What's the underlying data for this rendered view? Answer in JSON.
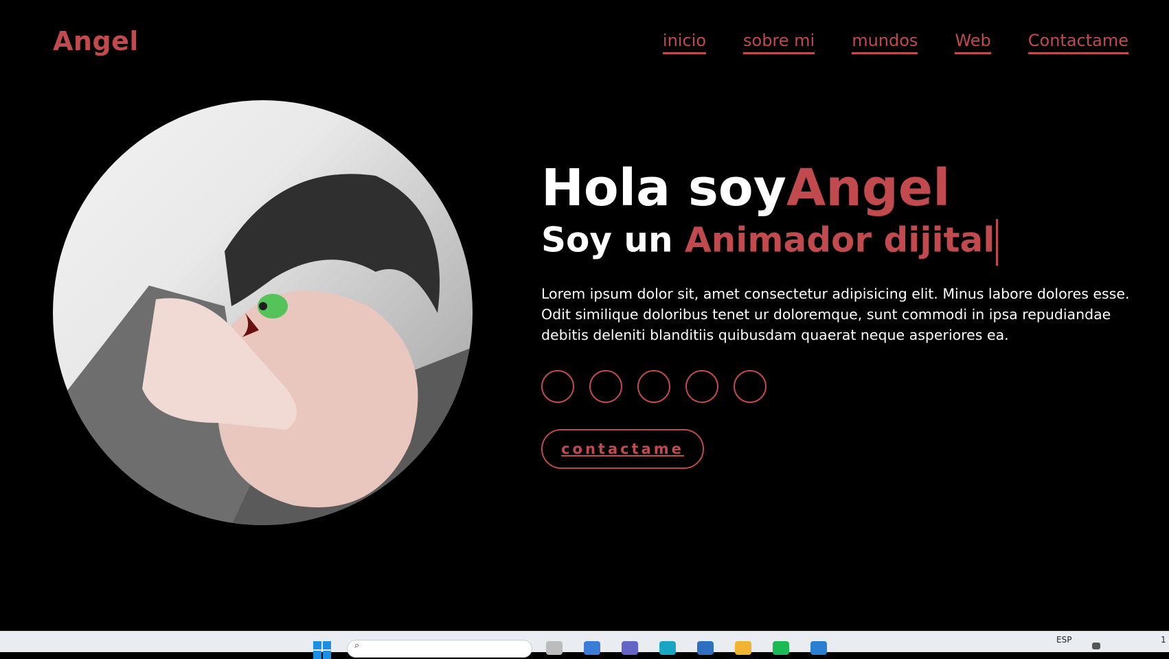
{
  "brand": "Angel",
  "nav": [
    "inicio",
    "sobre mi",
    "mundos",
    "Web",
    "Contactame"
  ],
  "hero": {
    "greeting": "Hola soy",
    "name": "Angel",
    "subtitle_lead": "Soy un ",
    "subtitle_role": "Animador dijital",
    "description": "Lorem ipsum dolor sit, amet consectetur adipisicing elit. Minus labore dolores esse. Odit similique doloribus tenet ur doloremque, sunt commodi in ipsa repudiandae debitis deleniti blanditiis quibusdam quaerat neque asperiores ea.",
    "cta": "contactame"
  },
  "socials": [
    "social-1",
    "social-2",
    "social-3",
    "social-4",
    "social-5"
  ],
  "taskbar": {
    "search_icon": "search-icon",
    "language": "ESP",
    "time_partial": "1"
  },
  "colors": {
    "accent": "#c04a4d",
    "background": "#000000",
    "text": "#ffffff"
  }
}
